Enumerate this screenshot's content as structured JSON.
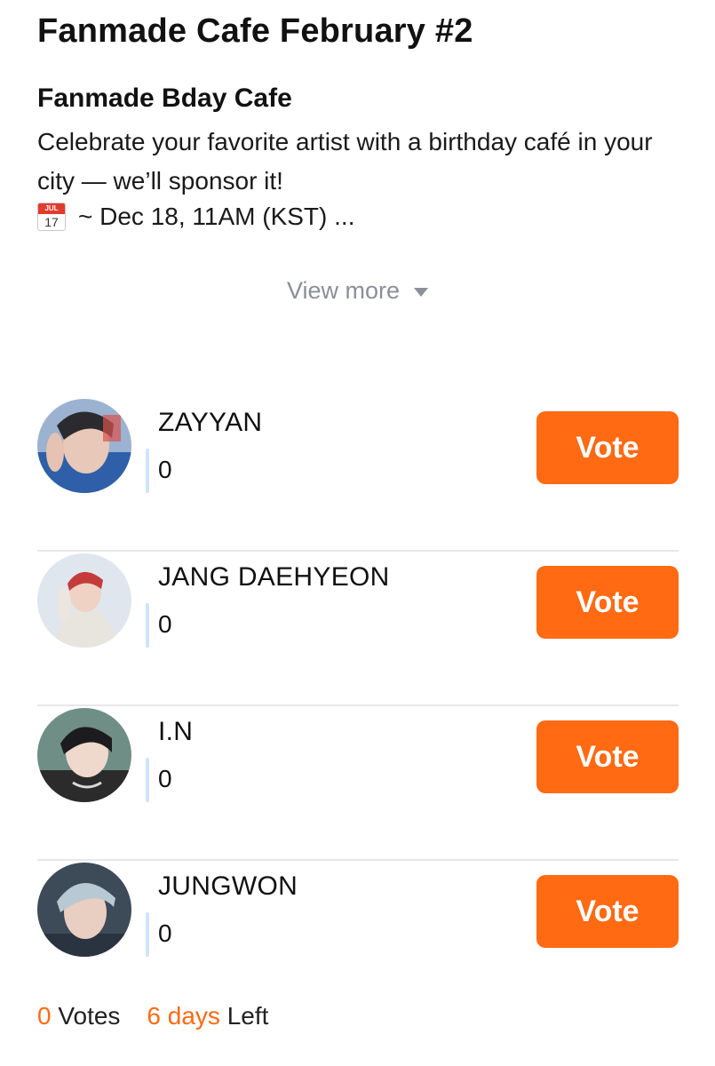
{
  "page": {
    "title": "Fanmade Cafe February #2",
    "subtitle": "Fanmade Bday Cafe",
    "description": "Celebrate your favorite artist with a birthday café in your city — we’ll sponsor it!",
    "calendar_icon": {
      "icon": "calendar-icon",
      "month": "JUL",
      "day": "17"
    },
    "date_text": "~ Dec 18, 11AM (KST) ...",
    "view_more_label": "View more"
  },
  "candidates": [
    {
      "name": "ZAYYAN",
      "votes": "0",
      "vote_label": "Vote"
    },
    {
      "name": "JANG DAEHYEON",
      "votes": "0",
      "vote_label": "Vote"
    },
    {
      "name": "I.N",
      "votes": "0",
      "vote_label": "Vote"
    },
    {
      "name": "JUNGWON",
      "votes": "0",
      "vote_label": "Vote"
    }
  ],
  "footer": {
    "total_votes": "0",
    "votes_label": "Votes",
    "days_left": "6 days",
    "left_label": "Left"
  },
  "colors": {
    "accent": "#ff6a13",
    "muted": "#8a8f98",
    "divider": "#e7e7e7"
  }
}
